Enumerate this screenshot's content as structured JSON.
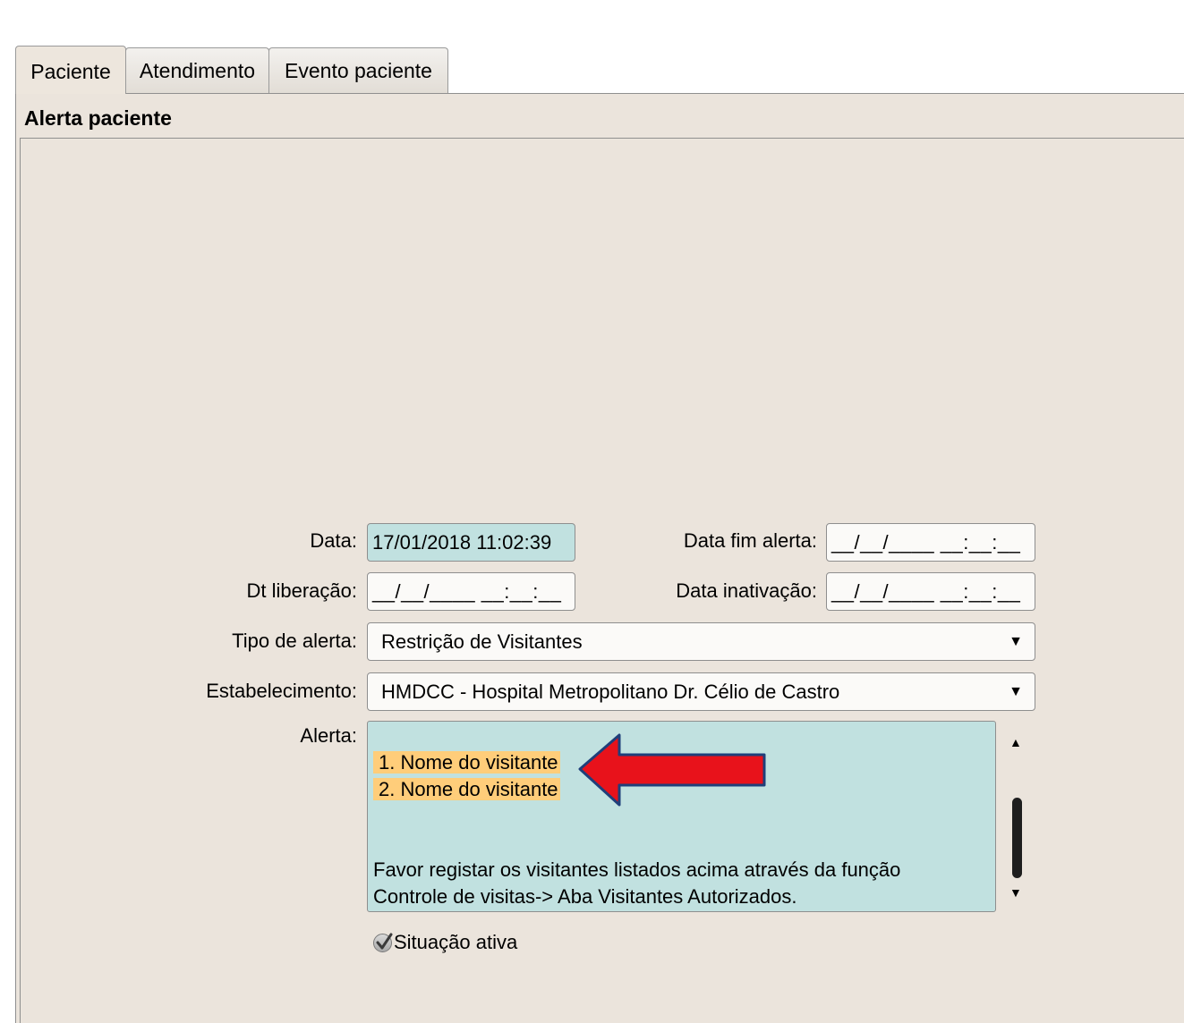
{
  "tabs": [
    {
      "label": "Paciente",
      "active": true
    },
    {
      "label": "Atendimento",
      "active": false
    },
    {
      "label": "Evento paciente",
      "active": false
    }
  ],
  "section_title": "Alerta paciente",
  "form": {
    "data_label": "Data:",
    "data_value": "17/01/2018 11:02:39",
    "data_fim_label": "Data fim alerta:",
    "data_fim_value": "__/__/____ __:__:__",
    "dt_liberacao_label": "Dt liberação:",
    "dt_liberacao_value": "__/__/____ __:__:__",
    "data_inativacao_label": "Data inativação:",
    "data_inativacao_value": "__/__/____ __:__:__",
    "tipo_alerta_label": "Tipo de alerta:",
    "tipo_alerta_value": "Restrição de Visitantes",
    "estabelecimento_label": "Estabelecimento:",
    "estabelecimento_value": "HMDCC - Hospital Metropolitano Dr. Célio de Castro",
    "alerta_label": "Alerta:",
    "alerta_lines": [
      "1. Nome do visitante",
      "2. Nome do visitante",
      "Favor registar os visitantes listados acima através da função",
      "Controle de visitas-> Aba Visitantes Autorizados."
    ],
    "situacao_label": "Situação ativa",
    "situacao_checked": true
  },
  "colors": {
    "highlight": "#ffcd7a",
    "readonly_bg": "#c1e1e0",
    "arrow_red": "#e8121b",
    "arrow_border": "#1f3f7a"
  }
}
